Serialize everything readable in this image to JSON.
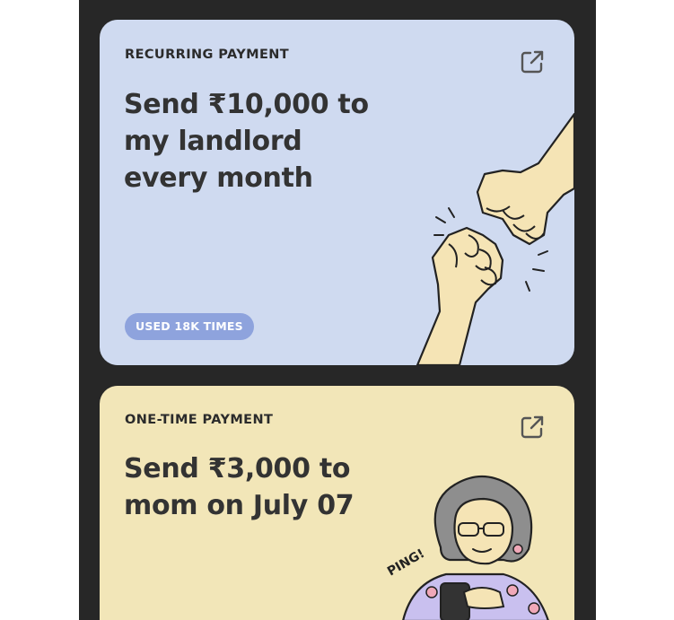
{
  "cards": [
    {
      "label": "RECURRING PAYMENT",
      "title": "Send ₹10,000 to my landlord every month",
      "badge": "USED 18K TIMES",
      "background": "#cfdaf0",
      "icon": "external-link-icon",
      "illustration": "fist-bump"
    },
    {
      "label": "ONE-TIME PAYMENT",
      "title": "Send ₹3,000 to mom on July 07",
      "background": "#f2e6b8",
      "icon": "external-link-icon",
      "illustration": "mom-with-phone",
      "illustration_text": "PING!"
    }
  ],
  "colors": {
    "frame": "#272727",
    "badge": "#8ea3dd",
    "text": "#333333"
  }
}
